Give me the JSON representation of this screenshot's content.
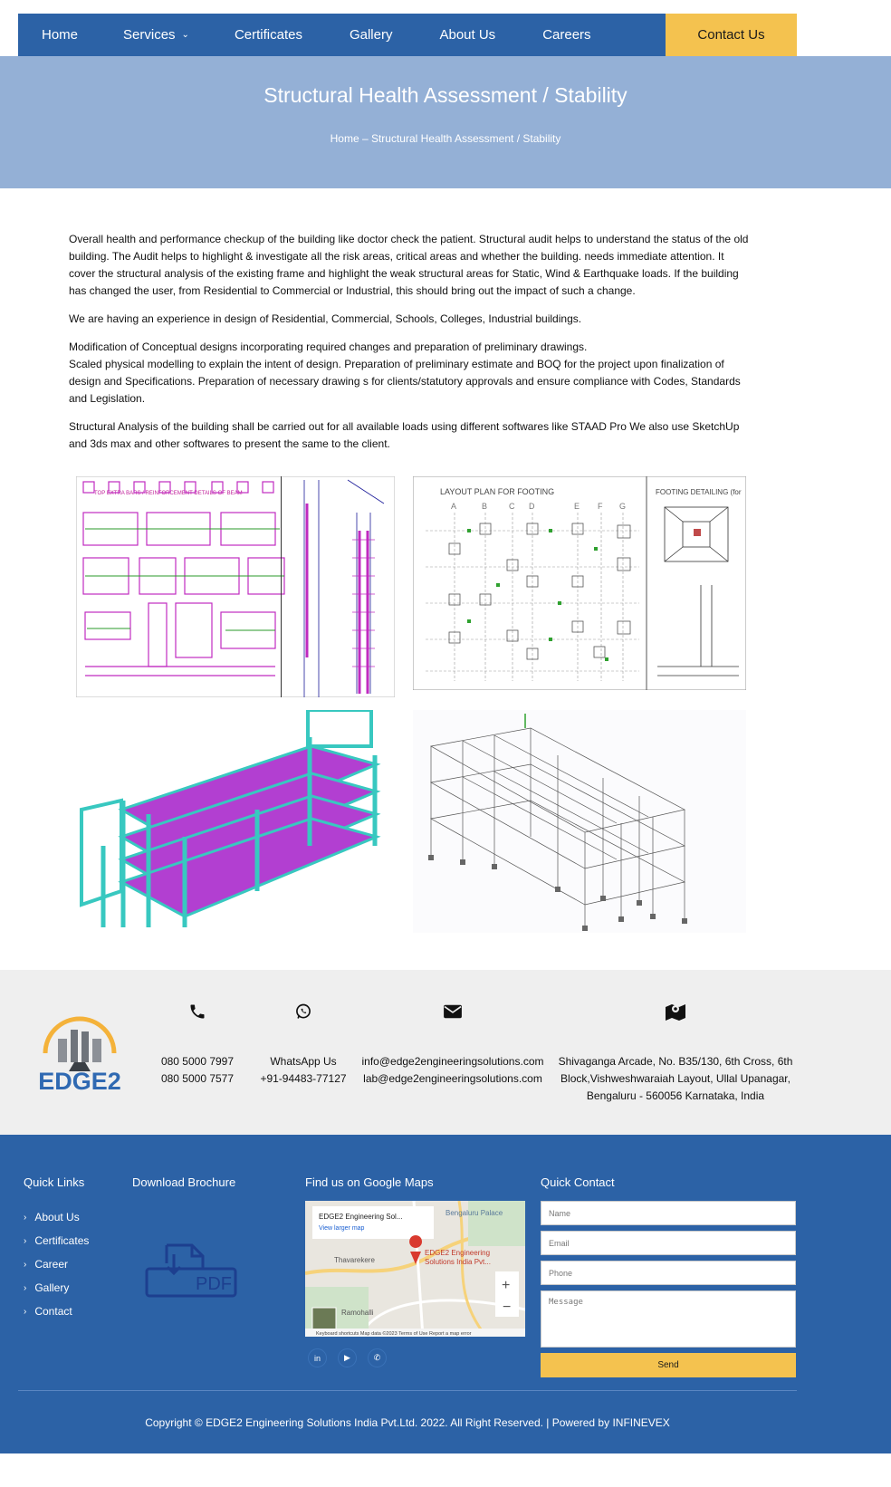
{
  "nav": {
    "items": [
      "Home",
      "Services",
      "Certificates",
      "Gallery",
      "About Us",
      "Careers"
    ],
    "contact_label": "Contact Us"
  },
  "hero": {
    "title": "Structural Health Assessment / Stability",
    "breadcrumb": "Home – Structural Health Assessment / Stability"
  },
  "content": {
    "paragraphs": [
      "Overall health and performance checkup of the building like doctor check the patient. Structural audit helps to understand the status of the old building. The Audit helps to highlight & investigate all the risk areas, critical areas and whether the building. needs immediate attention. It cover the structural analysis of the existing frame and highlight the weak structural areas for Static, Wind & Earthquake loads. If the building has changed the user, from Residential to Commercial or Industrial, this should bring out the impact of such a change.",
      "We are having an experience in design of Residential, Commercial, Schools, Colleges, Industrial buildings.",
      "Modification of Conceptual designs incorporating required changes and preparation of preliminary drawings.",
      "Scaled physical modelling to explain the intent of design. Preparation of preliminary estimate and BOQ for the project upon finalization of design and Specifications. Preparation of necessary drawing s for clients/statutory approvals and ensure compliance with Codes, Standards and Legislation.",
      "Structural Analysis of the building shall be carried out for all available loads using different softwares like STAAD Pro We also use SketchUp and 3ds max and other softwares to present the same to the client."
    ]
  },
  "images": {
    "beam_title": "TOP EXTRA BARS / REINFORCEMENT DETAILS OF BEAM",
    "footing_title": "LAYOUT PLAN FOR FOOTING",
    "footing_detail_title": "FOOTING DETAILING (for",
    "grid_labels": [
      "A",
      "B",
      "C",
      "D",
      "E",
      "F",
      "G"
    ]
  },
  "contact_strip": {
    "logo_text": "EDGE2",
    "phone_lines": [
      "080 5000 7997",
      "080 5000 7577"
    ],
    "whatsapp_lines": [
      "WhatsApp Us",
      "+91-94483-77127"
    ],
    "email_lines": [
      "info@edge2engineeringsolutions.com",
      "lab@edge2engineeringsolutions.com"
    ],
    "address_lines": [
      "Shivaganga Arcade, No. B35/130, 6th Cross, 6th",
      "Block,Vishweshwaraiah Layout, Ullal Upanagar,",
      "Bengaluru - 560056 Karnataka, India"
    ]
  },
  "footer": {
    "quick_links_title": "Quick Links",
    "quick_links": [
      "About Us",
      "Certificates",
      "Career",
      "Gallery",
      "Contact"
    ],
    "brochure_title": "Download Brochure",
    "pdf_label": "PDF",
    "map_title": "Find us on Google Maps",
    "map": {
      "place_name": "EDGE2 Engineering Sol...",
      "larger_map": "View larger map",
      "pin_label_1": "EDGE2 Engineering",
      "pin_label_2": "Solutions India Pvt...",
      "area_1": "Bengaluru Palace",
      "area_2": "Thavarekere",
      "area_3": "Ramohalli",
      "footer_text": "Keyboard shortcuts   Map data ©2023   Terms of Use   Report a map error"
    },
    "contact_title": "Quick Contact",
    "form": {
      "name_placeholder": "Name",
      "email_placeholder": "Email",
      "phone_placeholder": "Phone",
      "message_placeholder": "Message",
      "send_label": "Send"
    },
    "copyright": "Copyright © EDGE2 Engineering Solutions India Pvt.Ltd. 2022. All Right Reserved. | Powered by INFINEVEX"
  },
  "colors": {
    "brand_blue": "#2c62a6",
    "hero_blue": "#94b0d6",
    "accent_yellow": "#f4c24f"
  }
}
